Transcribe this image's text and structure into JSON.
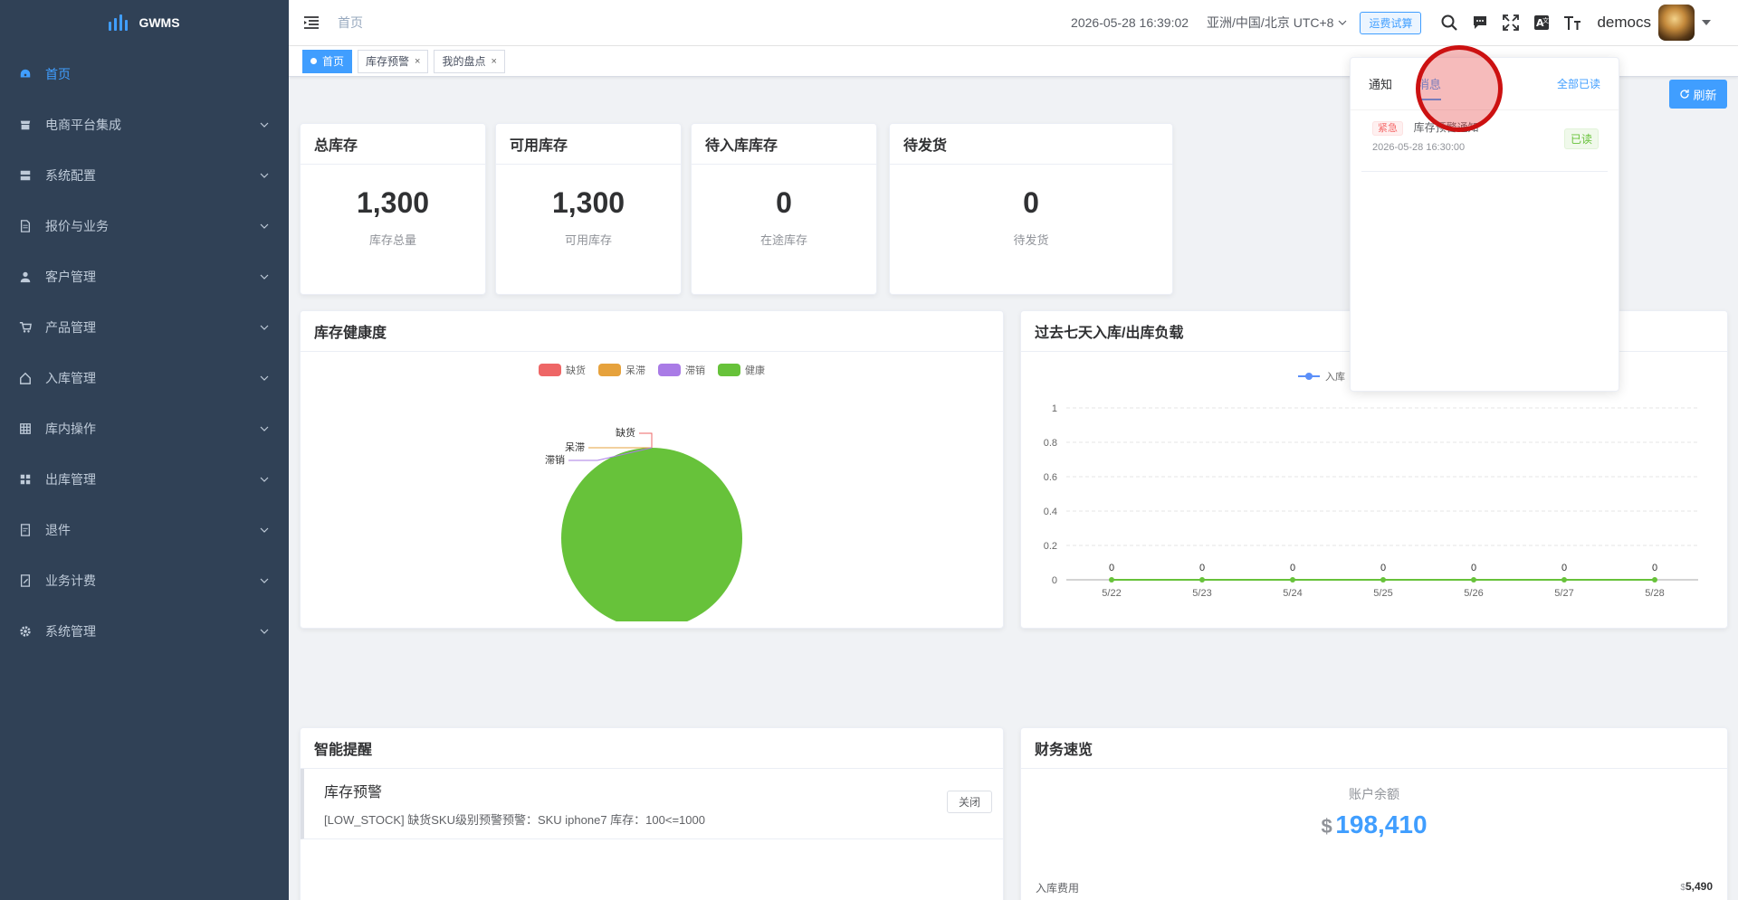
{
  "app": {
    "name": "GWMS"
  },
  "sidebar": {
    "items": [
      {
        "label": "首页",
        "icon": "dashboard-icon",
        "active": true,
        "expandable": false
      },
      {
        "label": "电商平台集成",
        "icon": "storefront-icon",
        "expandable": true
      },
      {
        "label": "系统配置",
        "icon": "database-icon",
        "expandable": true
      },
      {
        "label": "报价与业务",
        "icon": "document-icon",
        "expandable": true
      },
      {
        "label": "客户管理",
        "icon": "user-icon",
        "expandable": true
      },
      {
        "label": "产品管理",
        "icon": "cart-icon",
        "expandable": true
      },
      {
        "label": "入库管理",
        "icon": "home-icon",
        "expandable": true
      },
      {
        "label": "库内操作",
        "icon": "grid-icon",
        "expandable": true
      },
      {
        "label": "出库管理",
        "icon": "apps-icon",
        "expandable": true
      },
      {
        "label": "退件",
        "icon": "return-doc-icon",
        "expandable": true
      },
      {
        "label": "业务计费",
        "icon": "edit-doc-icon",
        "expandable": true
      },
      {
        "label": "系统管理",
        "icon": "gear-icon",
        "expandable": true
      }
    ]
  },
  "header": {
    "breadcrumb": "首页",
    "datetime": "2026-05-28 16:39:02",
    "timezone": "亚洲/中国/北京 UTC+8",
    "fee_button": "运费试算",
    "username": "democs"
  },
  "tags": [
    {
      "label": "首页",
      "active": true
    },
    {
      "label": "库存预警",
      "active": false
    },
    {
      "label": "我的盘点",
      "active": false
    }
  ],
  "refresh_label": "刷新",
  "stats": [
    {
      "title": "总库存",
      "value": "1,300",
      "label": "库存总量"
    },
    {
      "title": "可用库存",
      "value": "1,300",
      "label": "可用库存"
    },
    {
      "title": "待入库库存",
      "value": "0",
      "label": "在途库存"
    },
    {
      "title": "待发货",
      "value": "0",
      "label": "待发货"
    }
  ],
  "health_card": {
    "title": "库存健康度",
    "chart_data": {
      "type": "pie",
      "categories": [
        "缺货",
        "呆滞",
        "滞销",
        "健康"
      ],
      "values": [
        0,
        0,
        0,
        1300
      ],
      "colors": [
        "#ee6666",
        "#e6a23c",
        "#a97be6",
        "#67c23a"
      ],
      "legend": "top"
    }
  },
  "load_card": {
    "title": "过去七天入库/出库负载",
    "chart_data": {
      "type": "line",
      "x": [
        "5/22",
        "5/23",
        "5/24",
        "5/25",
        "5/26",
        "5/27",
        "5/28"
      ],
      "series": [
        {
          "name": "入库",
          "values": [
            0,
            0,
            0,
            0,
            0,
            0,
            0
          ],
          "color": "#5b8ff9"
        },
        {
          "values": [
            0,
            0,
            0,
            0,
            0,
            0,
            0
          ],
          "color": "#67c23a"
        }
      ],
      "ylim": [
        0,
        1
      ],
      "yticks": [
        "0",
        "0.2",
        "0.4",
        "0.6",
        "0.8",
        "1"
      ],
      "grid": true,
      "legend": "top"
    }
  },
  "smart_alerts": {
    "title": "智能提醒",
    "items": [
      {
        "title": "库存预警",
        "text": "[LOW_STOCK] 缺货SKU级别预警预警：SKU iphone7 库存：100<=1000",
        "close_label": "关闭"
      }
    ]
  },
  "finance": {
    "title": "财务速览",
    "balance_label": "账户余额",
    "currency": "$",
    "balance": "198,410",
    "rows": [
      {
        "label": "入库费用",
        "currency": "$",
        "value": "5,490"
      }
    ]
  },
  "notifications": {
    "tabs": [
      "通知",
      "消息"
    ],
    "active_tab": "消息",
    "mark_all_label": "全部已读",
    "messages": [
      {
        "tag": "紧急",
        "title": "库存预警通知",
        "time": "2026-05-28 16:30:00",
        "status": "已读"
      }
    ]
  },
  "colors": {
    "accent": "#409eff",
    "sidebar_bg": "#304156",
    "success": "#67c23a",
    "danger": "#f56c6c"
  }
}
